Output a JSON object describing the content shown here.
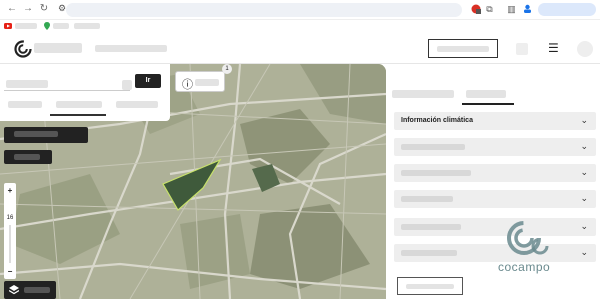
{
  "browser": {
    "nav": {
      "back": "←",
      "forward": "→",
      "reload": "↻"
    }
  },
  "search": {
    "go_label": "Ir"
  },
  "map": {
    "zoom_level": "16",
    "zoom_in": "+",
    "zoom_out": "−",
    "info_badge": "1",
    "info_icon": "ⓘ"
  },
  "panel": {
    "accordion": [
      {
        "label": "Información climática"
      },
      {
        "label": ""
      },
      {
        "label": ""
      },
      {
        "label": ""
      },
      {
        "label": ""
      },
      {
        "label": ""
      }
    ]
  },
  "watermark": {
    "text": "cocampo"
  },
  "colors": {
    "field_highlight": "#3f5a3b",
    "field_stroke": "#c8e26a",
    "chip_dark": "#222222"
  }
}
